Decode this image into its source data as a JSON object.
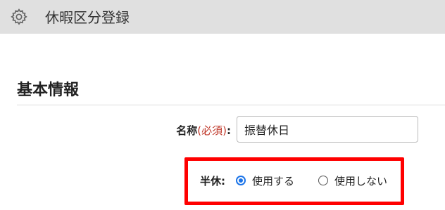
{
  "header": {
    "icon": "gear-icon",
    "title": "休暇区分登録"
  },
  "section": {
    "title": "基本情報"
  },
  "form": {
    "name": {
      "label": "名称",
      "required_text": "(必須)",
      "colon": ":",
      "value": "振替休日"
    },
    "half_day": {
      "label": "半休:",
      "options": [
        {
          "label": "使用する",
          "selected": true
        },
        {
          "label": "使用しない",
          "selected": false
        }
      ]
    }
  },
  "colors": {
    "header_bg": "#e0e0e0",
    "required": "#c0392b",
    "radio_accent": "#1a73e8",
    "highlight_border": "#ff0000"
  }
}
